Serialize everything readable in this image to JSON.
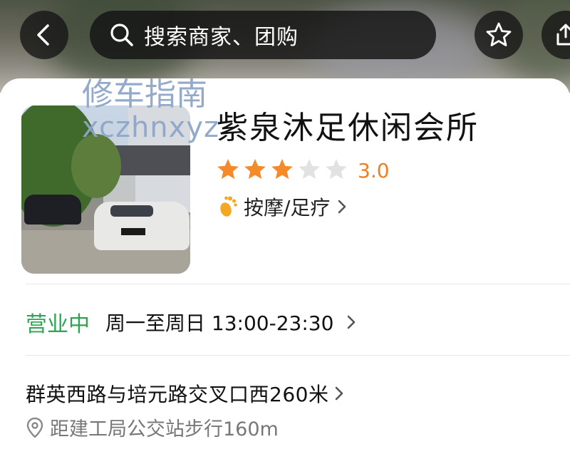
{
  "search": {
    "placeholder": "搜索商家、团购"
  },
  "watermark": {
    "line1": "修车指南",
    "line2": "xczhnxyz"
  },
  "shop": {
    "name": "紫泉沐足休闲会所",
    "rating": "3.0",
    "rating_value": 3.0,
    "stars_total": 5,
    "category": "按摩/足疗"
  },
  "hours": {
    "status": "营业中",
    "time": "周一至周日 13:00-23:30"
  },
  "address": {
    "street": "群英西路与培元路交叉口西260米",
    "distance": "距建工局公交站步行160m"
  },
  "colors": {
    "star_on": "#f48a2a",
    "star_off": "#e2e2e2",
    "rating": "#f17d1f",
    "open_status": "#2ca451",
    "foot_icon": "#f5a623"
  },
  "icons": [
    "back-arrow-icon",
    "search-icon",
    "star-outline-icon",
    "share-icon",
    "foot-icon",
    "location-pin-icon",
    "chevron-right-icon"
  ]
}
